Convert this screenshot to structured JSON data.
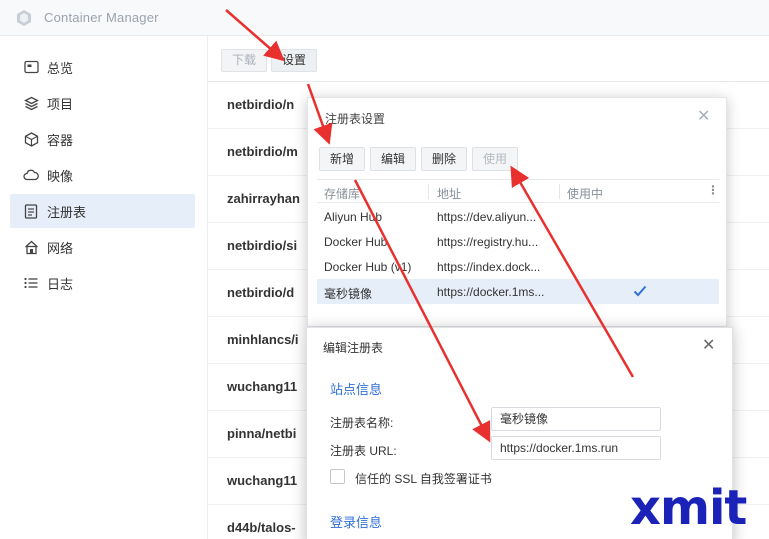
{
  "app": {
    "title": "Container Manager"
  },
  "sidebar": {
    "items": [
      {
        "label": "总览",
        "icon": "overview-icon"
      },
      {
        "label": "项目",
        "icon": "project-icon"
      },
      {
        "label": "容器",
        "icon": "container-icon"
      },
      {
        "label": "映像",
        "icon": "image-cloud-icon"
      },
      {
        "label": "注册表",
        "icon": "registry-icon"
      },
      {
        "label": "网络",
        "icon": "network-icon"
      },
      {
        "label": "日志",
        "icon": "log-list-icon"
      }
    ],
    "active_index": 4
  },
  "toolbar": {
    "download_label": "下载",
    "settings_label": "设置"
  },
  "images": [
    "netbirdio/n",
    "netbirdio/m",
    "zahirrayhan",
    "netbirdio/si",
    "netbirdio/d",
    "minhlancs/i",
    "wuchang11",
    "pinna/netbi",
    "wuchang11",
    "d44b/talos-"
  ],
  "registry_dialog": {
    "title": "注册表设置",
    "buttons": {
      "add": "新增",
      "edit": "编辑",
      "delete": "删除",
      "use": "使用"
    },
    "columns": {
      "repo": "存储库",
      "address": "地址",
      "in_use": "使用中"
    },
    "rows": [
      {
        "name": "Aliyun Hub",
        "url": "https://dev.aliyun...",
        "in_use": false
      },
      {
        "name": "Docker Hub",
        "url": "https://registry.hu...",
        "in_use": false
      },
      {
        "name": "Docker Hub (v1)",
        "url": "https://index.dock...",
        "in_use": false
      },
      {
        "name": "毫秒镜像",
        "url": "https://docker.1ms...",
        "in_use": true
      }
    ],
    "selected_index": 3
  },
  "edit_dialog": {
    "title": "编辑注册表",
    "site_section": "站点信息",
    "name_label": "注册表名称:",
    "name_value": "毫秒镜像",
    "url_label": "注册表 URL:",
    "url_value": "https://docker.1ms.run",
    "ssl_label": "信任的 SSL 自我签署证书",
    "ssl_checked": false,
    "login_section": "登录信息"
  },
  "watermark": "xmit",
  "colors": {
    "accent": "#2f6fd6",
    "arrow": "#e8312f",
    "selected_row": "#e6eef9",
    "watermark": "#1a22b8"
  }
}
